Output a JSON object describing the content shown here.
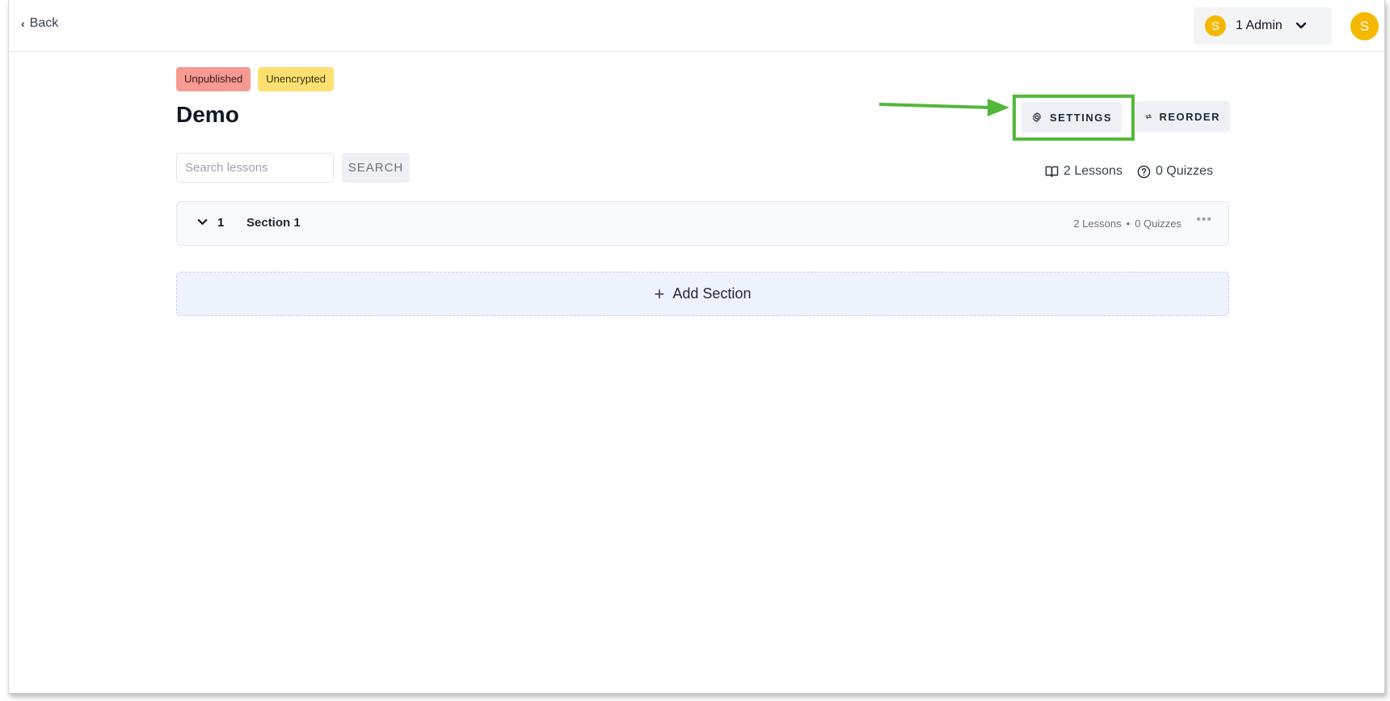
{
  "nav": {
    "back_label": "Back"
  },
  "org": {
    "avatar_letter": "S",
    "label": "1 Admin"
  },
  "user": {
    "avatar_letter": "S"
  },
  "course": {
    "badges": [
      {
        "label": "Unpublished",
        "color": "#f79a92"
      },
      {
        "label": "Unencrypted",
        "color": "#fde070"
      }
    ],
    "title": "Demo"
  },
  "actions": {
    "settings_label": "SETTINGS",
    "reorder_label": "REORDER"
  },
  "search": {
    "placeholder": "Search lessons",
    "value": "",
    "button_label": "SEARCH"
  },
  "stats": {
    "lessons": "2 Lessons",
    "quizzes": "0 Quizzes"
  },
  "sections": [
    {
      "number": "1",
      "name": "Section 1",
      "lessons": "2 Lessons",
      "separator": "•",
      "quizzes": "0 Quizzes"
    }
  ],
  "add_section_label": "Add Section",
  "colors": {
    "accent_avatar": "#f5b800",
    "highlight": "#53b83a"
  }
}
